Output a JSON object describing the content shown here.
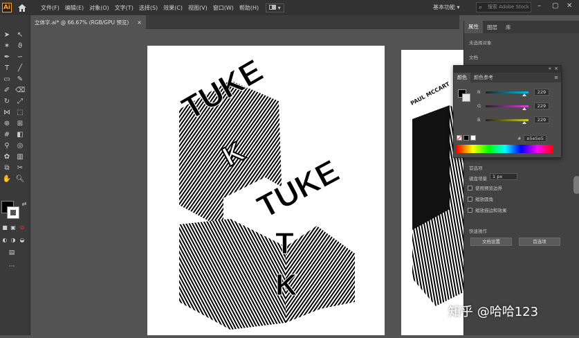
{
  "menubar": {
    "logo": "Ai",
    "items": [
      "文件(F)",
      "编辑(E)",
      "对象(O)",
      "文字(T)",
      "选择(S)",
      "效果(C)",
      "视图(V)",
      "窗口(W)",
      "帮助(H)"
    ],
    "workspace": "基本功能",
    "search_placeholder": "搜索 Adobe Stock"
  },
  "document_tab": {
    "title": "立体字.ai* @ 66.67% (RGB/GPU 预览)",
    "close": "×"
  },
  "properties_panel": {
    "tabs": [
      "属性",
      "图层",
      "库"
    ],
    "no_selection": "未选择对象",
    "section_doc": "文档",
    "guides_title": "首选项",
    "keyboard_increment_label": "键盘增量",
    "keyboard_increment_value": "1 px",
    "checkboxes": [
      "使用预览边界",
      "缩放圆角",
      "缩放描边和效果"
    ],
    "quick_actions_title": "快速操作",
    "buttons": [
      "文档设置",
      "首选项"
    ]
  },
  "color_panel": {
    "tabs": [
      "颜色",
      "颜色参考"
    ],
    "sliders": [
      {
        "label": "R",
        "value": "229",
        "color": "#00c0e0",
        "level": 0.9
      },
      {
        "label": "G",
        "value": "229",
        "color": "#e040e0",
        "level": 0.9
      },
      {
        "label": "B",
        "value": "229",
        "color": "#d0d020",
        "level": 0.9
      }
    ],
    "hex_label": "#",
    "hex_value": "e5e5e5"
  },
  "artwork": {
    "paul_text": "PAUL MCCART"
  },
  "watermark": "知乎 @哈哈123"
}
